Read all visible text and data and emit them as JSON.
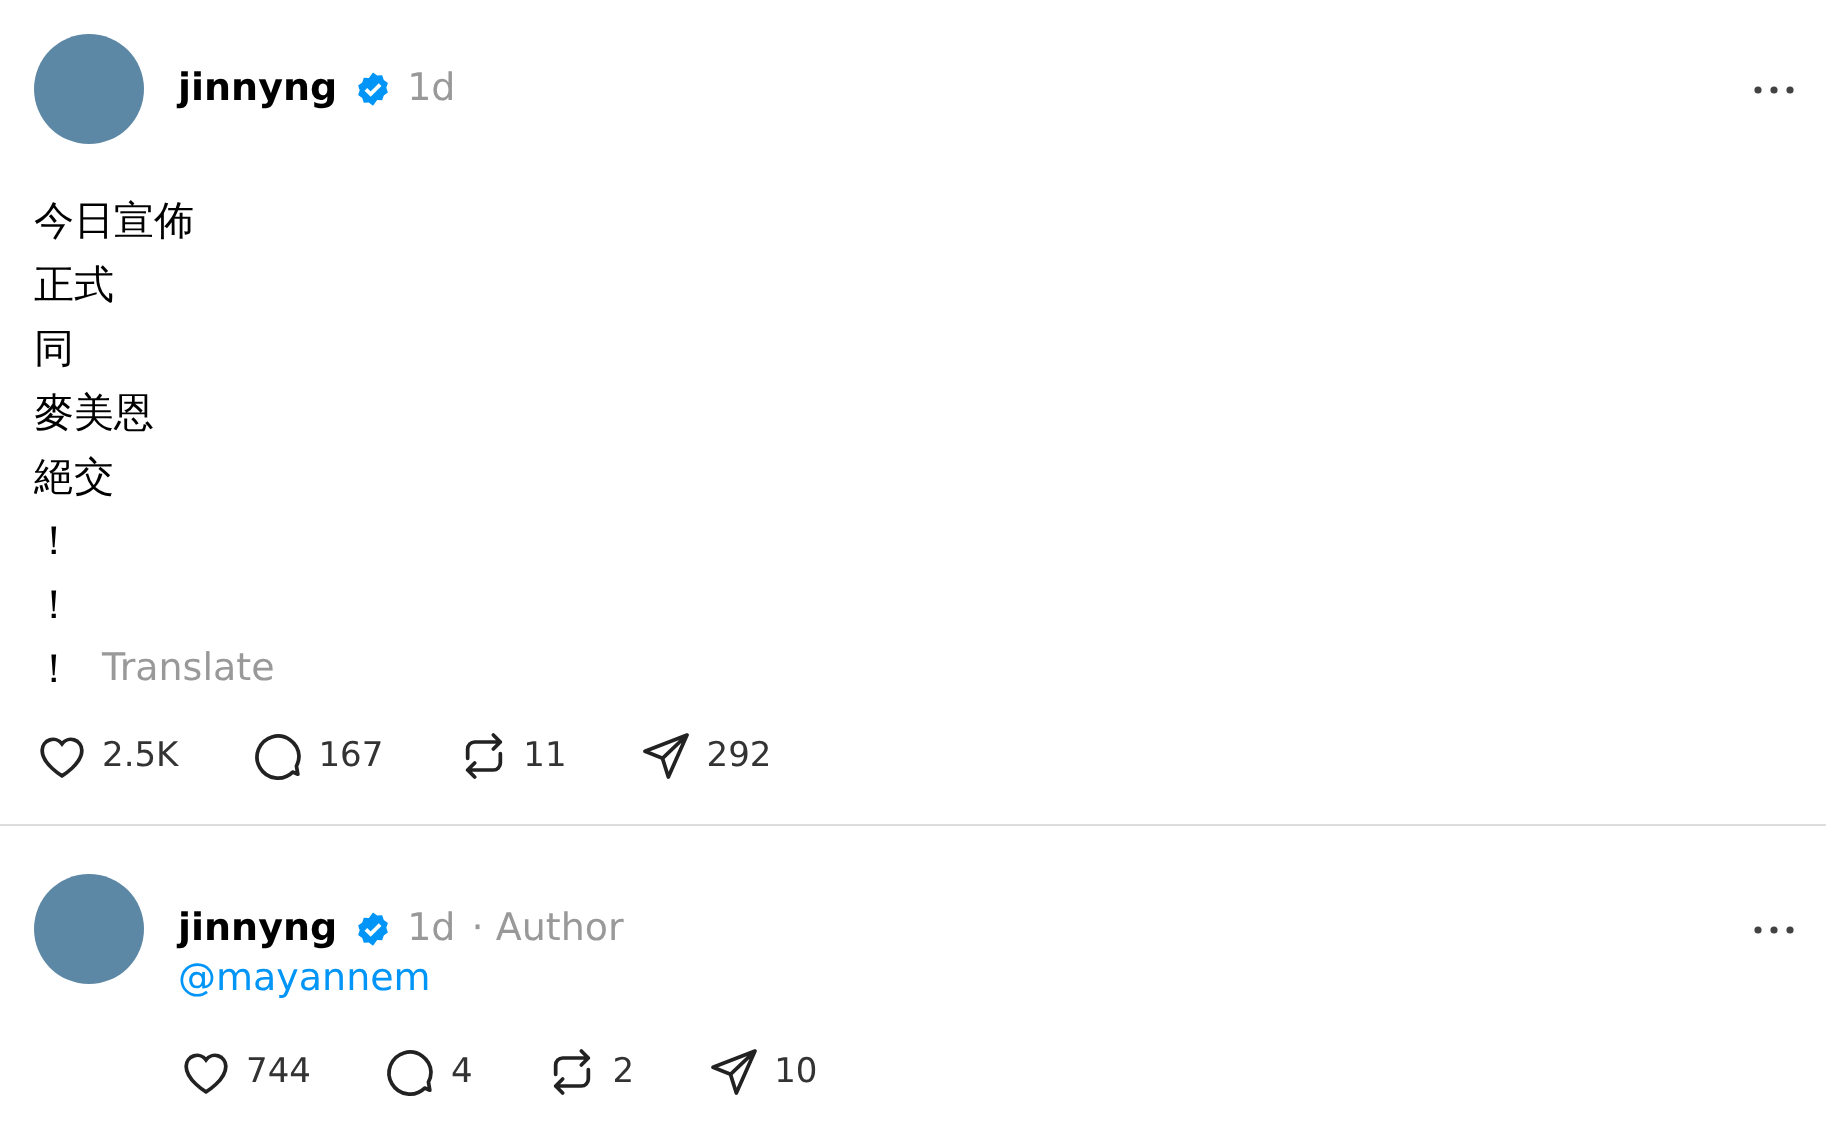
{
  "posts": [
    {
      "author": {
        "name": "jinnyng",
        "verified": true
      },
      "time": "1d",
      "body_lines": [
        "今日宣佈",
        "正式",
        "同",
        "麥美恩",
        "絕交",
        "！",
        "！",
        "！"
      ],
      "translate": "Translate",
      "actions": [
        {
          "kind": "like",
          "count": "2.5K"
        },
        {
          "kind": "comment",
          "count": "167"
        },
        {
          "kind": "repost",
          "count": "11"
        },
        {
          "kind": "share",
          "count": "292"
        }
      ]
    },
    {
      "author": {
        "name": "jinnyng",
        "verified": true
      },
      "time": "1d",
      "role": "· Author",
      "mention": "@mayannem",
      "actions": [
        {
          "kind": "like",
          "count": "744"
        },
        {
          "kind": "comment",
          "count": "4"
        },
        {
          "kind": "repost",
          "count": "2"
        },
        {
          "kind": "share",
          "count": "10"
        }
      ]
    }
  ]
}
